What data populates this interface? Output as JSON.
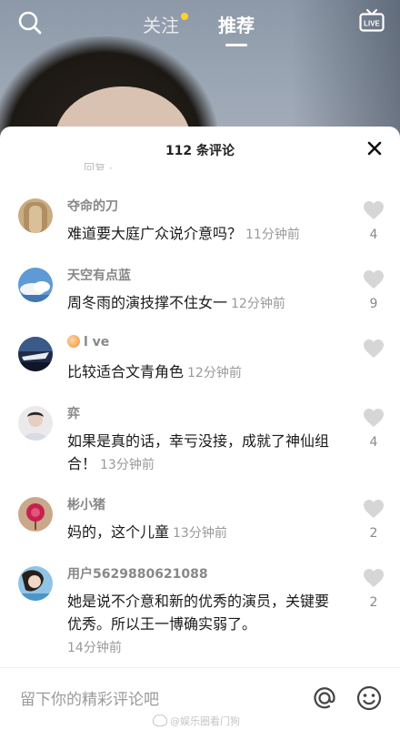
{
  "topnav": {
    "tabs": [
      {
        "label": "关注",
        "has_dot": true
      },
      {
        "label": "推荐",
        "active": true
      }
    ],
    "live_label": "LIVE",
    "icons": [
      "search-icon",
      "live-tv-icon"
    ]
  },
  "comments_panel": {
    "title": "112 条评论",
    "peek_text": "回复 ·",
    "items": [
      {
        "username": "夺命的刀",
        "text": "难道要大庭广众说介意吗？",
        "time": "11分钟前",
        "likes": "4"
      },
      {
        "username": "天空有点蓝",
        "text": "周冬雨的演技撑不住女一",
        "time": "12分钟前",
        "likes": "9"
      },
      {
        "username": "l ve",
        "text": "比较适合文青角色",
        "time": "12分钟前",
        "likes": ""
      },
      {
        "username": "弈",
        "text": "如果是真的话，幸亏没接，成就了神仙组合！",
        "time": "13分钟前",
        "likes": "4"
      },
      {
        "username": "彬小猪",
        "text": "妈的，这个儿童",
        "time": "13分钟前",
        "likes": "2"
      },
      {
        "username": "用户5629880621088",
        "text": "她是说不介意和新的优秀的演员，关键要优秀。所以王一博确实弱了。",
        "time": "14分钟前",
        "likes": "2"
      }
    ]
  },
  "composer": {
    "placeholder": "留下你的精彩评论吧",
    "icons": [
      "at-icon",
      "emoji-icon"
    ]
  },
  "watermark": "@娱乐圈看门狗",
  "colors": {
    "like_gray": "#d6d6d6",
    "time_gray": "#999999",
    "following_dot": "#ffd02a"
  }
}
